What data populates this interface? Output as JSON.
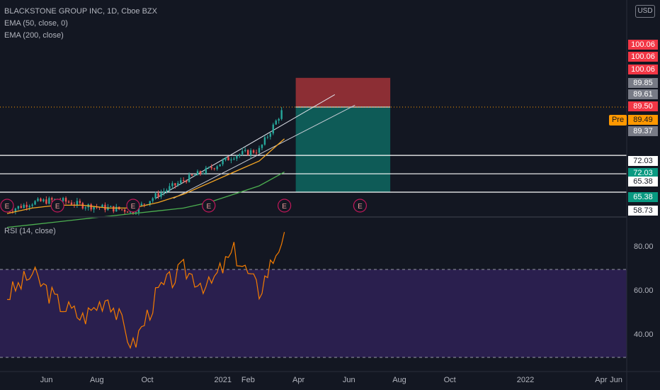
{
  "header": {
    "title": "BLACKSTONE GROUP INC, 1D, Cboe BZX",
    "ema50": "EMA (50, close, 0)",
    "ema200": "EMA (200, close)",
    "currency": "USD"
  },
  "rsi_pane": {
    "label": "RSI (14, close)"
  },
  "price_labels": [
    {
      "text": "100.06",
      "color": "#f23645",
      "fg": "#ffffff"
    },
    {
      "text": "100.06",
      "color": "#f23645",
      "fg": "#ffffff"
    },
    {
      "text": "100.06",
      "color": "#f23645",
      "fg": "#ffffff"
    },
    {
      "text": "89.85",
      "color": "#787b86",
      "fg": "#ffffff"
    },
    {
      "text": "89.61",
      "color": "#787b86",
      "fg": "#ffffff"
    },
    {
      "text": "89.50",
      "color": "#f23645",
      "fg": "#ffffff"
    },
    {
      "text": "89.49",
      "color": "#ff9800",
      "fg": "#131722"
    },
    {
      "text": "89.37",
      "color": "#787b86",
      "fg": "#ffffff"
    },
    {
      "text": "72.03",
      "color": "#ffffff",
      "fg": "#131722"
    },
    {
      "text": "72.03",
      "color": "#089981",
      "fg": "#ffffff"
    },
    {
      "text": "65.38",
      "color": "#ffffff",
      "fg": "#131722"
    },
    {
      "text": "65.38",
      "color": "#089981",
      "fg": "#ffffff"
    },
    {
      "text": "58.73",
      "color": "#ffffff",
      "fg": "#131722"
    }
  ],
  "pre_label": "Pre",
  "earnings_marker": "E",
  "rsi_axis_ticks": [
    "80.00",
    "60.00",
    "40.00"
  ],
  "x_axis_ticks": [
    "Jun",
    "Aug",
    "Oct",
    "2021",
    "Feb",
    "Apr",
    "Jun",
    "Aug",
    "Oct",
    "2022",
    "Apr",
    "Jun"
  ],
  "colors": {
    "background": "#131722",
    "candle_up": "#26a69a",
    "candle_down": "#ef5350",
    "ema50": "#f5a623",
    "ema200": "#4caf50",
    "rsi_line": "#f57c00",
    "rsi_band": "#2a1f4e",
    "stop_zone": "#8c2e34",
    "target_zone": "#0e5b57"
  },
  "chart_data": [
    {
      "type": "candlestick",
      "title": "BLACKSTONE GROUP INC, 1D, Cboe BZX",
      "xlabel": "",
      "ylabel": "",
      "x": [
        "2020-05",
        "2020-06",
        "2020-07",
        "2020-08",
        "2020-09",
        "2020-10",
        "2020-11",
        "2020-12",
        "2021-01",
        "2021-02",
        "2021-03",
        "2021-04"
      ],
      "close": [
        52,
        55,
        56,
        54,
        53,
        52,
        58,
        63,
        67,
        72,
        74,
        89.49
      ],
      "series": [
        {
          "name": "EMA (50, close, 0)",
          "values": [
            51,
            53,
            54,
            54,
            53,
            53,
            55,
            58,
            62,
            66,
            70,
            78
          ]
        },
        {
          "name": "EMA (200, close)",
          "values": [
            46,
            47,
            48,
            49,
            50,
            51,
            52,
            53,
            55,
            58,
            61,
            66
          ]
        }
      ],
      "horizontal_levels": [
        72.03,
        65.38,
        58.73
      ],
      "last_price": 89.49,
      "position_tool": {
        "entry": 89.5,
        "stop": 100.06,
        "target": 58.73
      },
      "earnings_events": [
        "2020-05",
        "2020-07",
        "2020-10",
        "2021-01",
        "2021-04",
        "2021-07"
      ]
    },
    {
      "type": "line",
      "title": "RSI (14, close)",
      "ylim": [
        30,
        90
      ],
      "bands": [
        30,
        70
      ],
      "x": [
        "2020-05",
        "2020-06",
        "2020-07",
        "2020-08",
        "2020-09",
        "2020-10",
        "2020-11",
        "2020-12",
        "2021-01",
        "2021-02",
        "2021-03",
        "2021-04"
      ],
      "values": [
        58,
        68,
        55,
        48,
        58,
        35,
        60,
        70,
        62,
        78,
        60,
        87
      ]
    }
  ]
}
